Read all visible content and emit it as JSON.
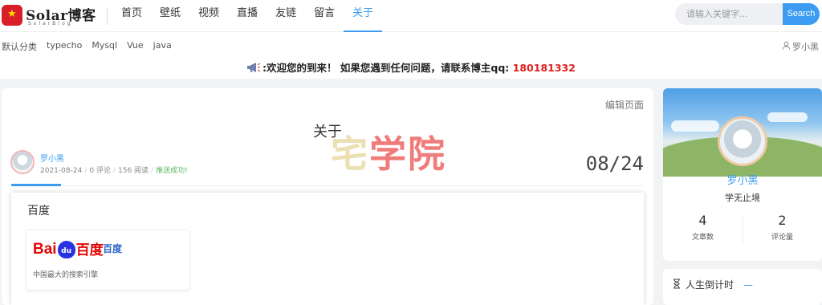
{
  "header": {
    "logo_title": "Solar博客",
    "logo_subtitle": "SolarBlog",
    "nav": [
      "首页",
      "壁纸",
      "视频",
      "直播",
      "友链",
      "留言",
      "关于"
    ],
    "active_nav": "关于",
    "search_placeholder": "请输入关键字...",
    "search_button": "Search"
  },
  "subnav": {
    "categories": [
      "默认分类",
      "typecho",
      "Mysql",
      "Vue",
      "java"
    ],
    "user": "罗小黑",
    "notice_text": ":欢迎您的到来！ 如果您遇到任何问题，请联系博主qq: ",
    "notice_qq": "180181332"
  },
  "post": {
    "edit_link": "编辑页面",
    "title": "关于",
    "watermark_part1": "宅",
    "watermark_part2": "学院",
    "author": "罗小黑",
    "date": "2021-08-24",
    "comments": "0 评论",
    "views": "156 阅读",
    "push_status": "推送成功!",
    "date_badge": "08/24",
    "content_heading": "百度",
    "link_card": {
      "logo_text_1": "Bai",
      "logo_text_paw": "du",
      "logo_text_2": "百度",
      "title": "百度",
      "description": "中国最大的搜索引擎"
    }
  },
  "sidebar": {
    "name": "罗小黑",
    "motto": "学无止境",
    "stats": [
      {
        "num": "4",
        "label": "文章数"
      },
      {
        "num": "2",
        "label": "评论量"
      }
    ],
    "countdown_title": "人生倒计时",
    "countdown_dash": "—"
  },
  "colors": {
    "accent": "#3b9cf2",
    "qq_red": "#e02020",
    "logo_red": "#d71e29",
    "push_green": "#5cb85c"
  }
}
